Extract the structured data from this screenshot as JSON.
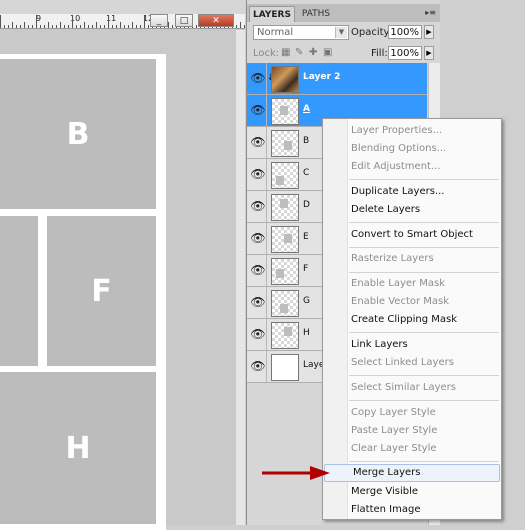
{
  "document": {
    "ruler_numbers": [
      "9",
      "10",
      "11",
      "12"
    ],
    "cells": [
      "B",
      "F",
      "H"
    ]
  },
  "window_buttons": {
    "minimize": "_",
    "restore": "□",
    "close": "✕"
  },
  "panel": {
    "tabs": [
      "LAYERS",
      "PATHS"
    ],
    "menu_icon": "panel-menu-icon",
    "blend_mode": "Normal",
    "opacity_label": "Opacity:",
    "opacity_value": "100%",
    "lock_label": "Lock:",
    "fill_label": "Fill:",
    "fill_value": "100%",
    "layers": [
      {
        "name": "Layer 2",
        "selected": true,
        "thumb": "photo",
        "clipped": true
      },
      {
        "name": "A",
        "selected": true,
        "thumb": "checker"
      },
      {
        "name": "B",
        "selected": false,
        "thumb": "checker"
      },
      {
        "name": "C",
        "selected": false,
        "thumb": "checker"
      },
      {
        "name": "D",
        "selected": false,
        "thumb": "checker"
      },
      {
        "name": "E",
        "selected": false,
        "thumb": "checker"
      },
      {
        "name": "F",
        "selected": false,
        "thumb": "checker"
      },
      {
        "name": "G",
        "selected": false,
        "thumb": "checker"
      },
      {
        "name": "H",
        "selected": false,
        "thumb": "checker"
      },
      {
        "name": "Laye",
        "selected": false,
        "thumb": "white"
      }
    ]
  },
  "context_menu": {
    "groups": [
      [
        {
          "label": "Layer Properties...",
          "enabled": false
        },
        {
          "label": "Blending Options...",
          "enabled": false
        },
        {
          "label": "Edit Adjustment...",
          "enabled": false
        }
      ],
      [
        {
          "label": "Duplicate Layers...",
          "enabled": true
        },
        {
          "label": "Delete Layers",
          "enabled": true
        }
      ],
      [
        {
          "label": "Convert to Smart Object",
          "enabled": true
        }
      ],
      [
        {
          "label": "Rasterize Layers",
          "enabled": false
        }
      ],
      [
        {
          "label": "Enable Layer Mask",
          "enabled": false
        },
        {
          "label": "Enable Vector Mask",
          "enabled": false
        },
        {
          "label": "Create Clipping Mask",
          "enabled": true
        }
      ],
      [
        {
          "label": "Link Layers",
          "enabled": true
        },
        {
          "label": "Select Linked Layers",
          "enabled": false
        }
      ],
      [
        {
          "label": "Select Similar Layers",
          "enabled": false
        }
      ],
      [
        {
          "label": "Copy Layer Style",
          "enabled": false
        },
        {
          "label": "Paste Layer Style",
          "enabled": false
        },
        {
          "label": "Clear Layer Style",
          "enabled": false
        }
      ],
      [
        {
          "label": "Merge Layers",
          "enabled": true,
          "highlighted": true
        },
        {
          "label": "Merge Visible",
          "enabled": true
        },
        {
          "label": "Flatten Image",
          "enabled": true
        }
      ]
    ]
  },
  "colors": {
    "selection": "#3399ff",
    "annotation_arrow": "#b00000"
  }
}
